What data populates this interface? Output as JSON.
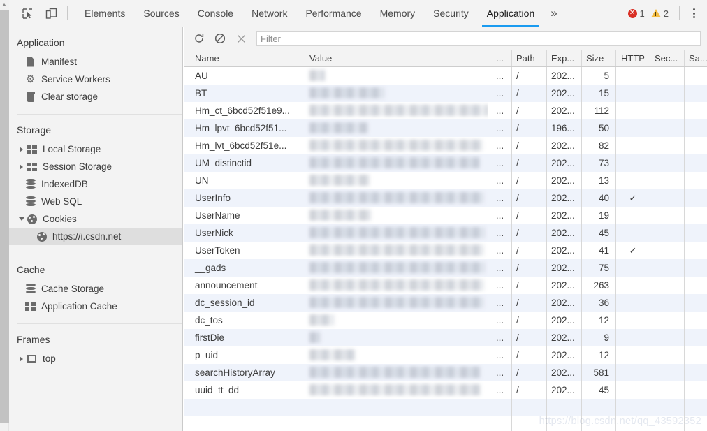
{
  "topbar": {
    "icons": [
      {
        "name": "inspect-element-icon",
        "title": "Inspect"
      },
      {
        "name": "device-toolbar-icon",
        "title": "Toggle device toolbar"
      }
    ],
    "tabs": [
      {
        "label": "Elements",
        "active": false
      },
      {
        "label": "Sources",
        "active": false
      },
      {
        "label": "Console",
        "active": false
      },
      {
        "label": "Network",
        "active": false
      },
      {
        "label": "Performance",
        "active": false
      },
      {
        "label": "Memory",
        "active": false
      },
      {
        "label": "Security",
        "active": false
      },
      {
        "label": "Application",
        "active": true
      }
    ],
    "more_label": "»",
    "error_count": "1",
    "warning_count": "2",
    "error_color": "#d93025",
    "warning_color": "#f5bc42",
    "active_tab_color": "#1a9bf0"
  },
  "sidebar": {
    "sections": [
      {
        "title": "Application",
        "items": [
          {
            "label": "Manifest",
            "icon": "document-icon",
            "arrow": "none",
            "indent": 1,
            "selected": false
          },
          {
            "label": "Service Workers",
            "icon": "gear-icon",
            "arrow": "none",
            "indent": 1,
            "selected": false
          },
          {
            "label": "Clear storage",
            "icon": "trash-icon",
            "arrow": "none",
            "indent": 1,
            "selected": false
          }
        ]
      },
      {
        "title": "Storage",
        "items": [
          {
            "label": "Local Storage",
            "icon": "grid-icon",
            "arrow": "collapsed",
            "indent": 0,
            "selected": false
          },
          {
            "label": "Session Storage",
            "icon": "grid-icon",
            "arrow": "collapsed",
            "indent": 0,
            "selected": false
          },
          {
            "label": "IndexedDB",
            "icon": "database-icon",
            "arrow": "none",
            "indent": 1,
            "selected": false
          },
          {
            "label": "Web SQL",
            "icon": "database-icon",
            "arrow": "none",
            "indent": 1,
            "selected": false
          },
          {
            "label": "Cookies",
            "icon": "cookie-icon",
            "arrow": "expanded",
            "indent": 0,
            "selected": false
          },
          {
            "label": "https://i.csdn.net",
            "icon": "cookie-icon",
            "arrow": "none",
            "indent": 2,
            "selected": true
          }
        ]
      },
      {
        "title": "Cache",
        "items": [
          {
            "label": "Cache Storage",
            "icon": "database-icon",
            "arrow": "none",
            "indent": 1,
            "selected": false
          },
          {
            "label": "Application Cache",
            "icon": "grid-icon",
            "arrow": "none",
            "indent": 1,
            "selected": false
          }
        ]
      },
      {
        "title": "Frames",
        "items": [
          {
            "label": "top",
            "icon": "frame-icon",
            "arrow": "collapsed",
            "indent": 0,
            "selected": false
          }
        ]
      }
    ]
  },
  "filterbar": {
    "refresh_label": "refresh-icon",
    "clear_label": "clear-icon",
    "close_label": "close-icon",
    "filter_placeholder": "Filter",
    "filter_value": ""
  },
  "table": {
    "columns": [
      {
        "label": "Name",
        "key": "name"
      },
      {
        "label": "Value",
        "key": "value"
      },
      {
        "label": "...",
        "key": "dots"
      },
      {
        "label": "Path",
        "key": "path"
      },
      {
        "label": "Exp...",
        "key": "exp"
      },
      {
        "label": "Size",
        "key": "size"
      },
      {
        "label": "HTTP",
        "key": "http"
      },
      {
        "label": "Sec...",
        "key": "sec"
      },
      {
        "label": "Sa...",
        "key": "sa"
      }
    ],
    "rows": [
      {
        "name": "AU",
        "value_redacted": true,
        "value_width": 22,
        "dots": "...",
        "path": "/",
        "exp": "202...",
        "size": "5",
        "http": "",
        "sec": "",
        "sa": ""
      },
      {
        "name": "BT",
        "value_redacted": true,
        "value_width": 108,
        "dots": "...",
        "path": "/",
        "exp": "202...",
        "size": "15",
        "http": "",
        "sec": "",
        "sa": ""
      },
      {
        "name": "Hm_ct_6bcd52f51e9...",
        "value_redacted": true,
        "value_width": 256,
        "dots": "...",
        "path": "/",
        "exp": "202...",
        "size": "112",
        "http": "",
        "sec": "",
        "sa": ""
      },
      {
        "name": "Hm_lpvt_6bcd52f51...",
        "value_redacted": true,
        "value_width": 84,
        "dots": "...",
        "path": "/",
        "exp": "196...",
        "size": "50",
        "http": "",
        "sec": "",
        "sa": ""
      },
      {
        "name": "Hm_lvt_6bcd52f51e...",
        "value_redacted": true,
        "value_width": 248,
        "dots": "...",
        "path": "/",
        "exp": "202...",
        "size": "82",
        "http": "",
        "sec": "",
        "sa": ""
      },
      {
        "name": "UM_distinctid",
        "value_redacted": true,
        "value_width": 244,
        "dots": "...",
        "path": "/",
        "exp": "202...",
        "size": "73",
        "http": "",
        "sec": "",
        "sa": ""
      },
      {
        "name": "UN",
        "value_redacted": true,
        "value_width": 86,
        "dots": "...",
        "path": "/",
        "exp": "202...",
        "size": "13",
        "http": "",
        "sec": "",
        "sa": ""
      },
      {
        "name": "UserInfo",
        "value_redacted": true,
        "value_width": 250,
        "dots": "...",
        "path": "/",
        "exp": "202...",
        "size": "40",
        "http": "✓",
        "sec": "",
        "sa": ""
      },
      {
        "name": "UserName",
        "value_redacted": true,
        "value_width": 88,
        "dots": "...",
        "path": "/",
        "exp": "202...",
        "size": "19",
        "http": "",
        "sec": "",
        "sa": ""
      },
      {
        "name": "UserNick",
        "value_redacted": true,
        "value_width": 252,
        "dots": "...",
        "path": "/",
        "exp": "202...",
        "size": "45",
        "http": "",
        "sec": "",
        "sa": ""
      },
      {
        "name": "UserToken",
        "value_redacted": true,
        "value_width": 250,
        "dots": "...",
        "path": "/",
        "exp": "202...",
        "size": "41",
        "http": "✓",
        "sec": "",
        "sa": ""
      },
      {
        "name": "__gads",
        "value_redacted": true,
        "value_width": 252,
        "dots": "...",
        "path": "/",
        "exp": "202...",
        "size": "75",
        "http": "",
        "sec": "",
        "sa": ""
      },
      {
        "name": "announcement",
        "value_redacted": true,
        "value_width": 250,
        "dots": "...",
        "path": "/",
        "exp": "202...",
        "size": "263",
        "http": "",
        "sec": "",
        "sa": ""
      },
      {
        "name": "dc_session_id",
        "value_redacted": true,
        "value_width": 250,
        "dots": "...",
        "path": "/",
        "exp": "202...",
        "size": "36",
        "http": "",
        "sec": "",
        "sa": ""
      },
      {
        "name": "dc_tos",
        "value_redacted": true,
        "value_width": 36,
        "dots": "...",
        "path": "/",
        "exp": "202...",
        "size": "12",
        "http": "",
        "sec": "",
        "sa": ""
      },
      {
        "name": "firstDie",
        "value_redacted": true,
        "value_width": 16,
        "dots": "...",
        "path": "/",
        "exp": "202...",
        "size": "9",
        "http": "",
        "sec": "",
        "sa": ""
      },
      {
        "name": "p_uid",
        "value_redacted": true,
        "value_width": 66,
        "dots": "...",
        "path": "/",
        "exp": "202...",
        "size": "12",
        "http": "",
        "sec": "",
        "sa": ""
      },
      {
        "name": "searchHistoryArray",
        "value_redacted": true,
        "value_width": 245,
        "dots": "...",
        "path": "/",
        "exp": "202...",
        "size": "581",
        "http": "",
        "sec": "",
        "sa": ""
      },
      {
        "name": "uuid_tt_dd",
        "value_redacted": true,
        "value_width": 245,
        "dots": "...",
        "path": "/",
        "exp": "202...",
        "size": "45",
        "http": "",
        "sec": "",
        "sa": ""
      }
    ]
  },
  "watermark": {
    "text": "https://blog.csdn.net/qq_43592352"
  }
}
